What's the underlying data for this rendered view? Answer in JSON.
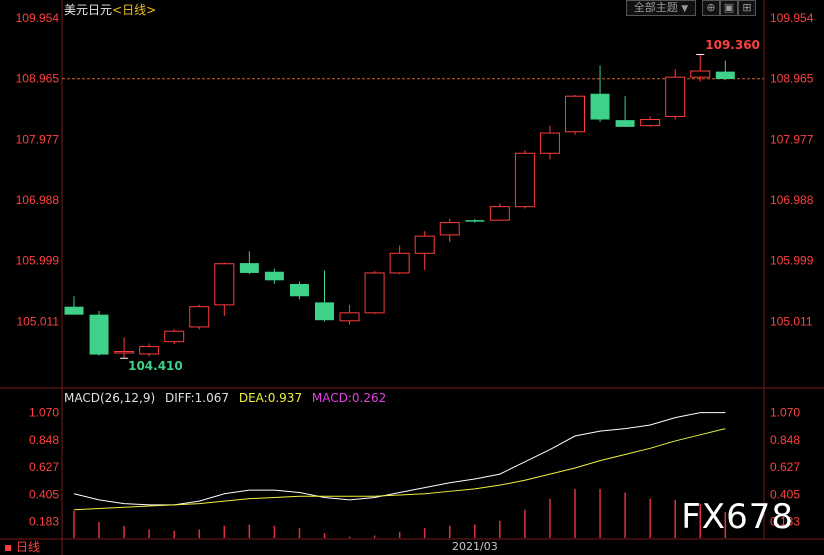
{
  "header": {
    "symbol": "美元日元",
    "period": "<日线>"
  },
  "toolbar": {
    "all_themes": "全部主题",
    "dropdown_glyph": "▼",
    "icon1": "⊕",
    "icon2": "▣",
    "icon3": "⊞"
  },
  "price_axis": {
    "ticks": [
      "109.954",
      "108.965",
      "107.977",
      "106.988",
      "105.999",
      "105.011"
    ]
  },
  "macd_axis": {
    "ticks": [
      "1.070",
      "0.848",
      "0.627",
      "0.405",
      "0.183"
    ]
  },
  "macd_header": {
    "title": "MACD(26,12,9)",
    "diff": "DIFF:1.067",
    "dea": "DEA:0.937",
    "macd": "MACD:0.262"
  },
  "annotations": {
    "high": "109.360",
    "low": "104.410"
  },
  "bottom": {
    "tab": "日线",
    "month": "2021/03"
  },
  "watermark": "FX678",
  "colors": {
    "up": "#ff3c3c",
    "down": "#3fd08a",
    "diff_line": "#ffffff",
    "dea_line": "#f0f040",
    "macd_text": "#e040e0",
    "axis_text": "#ff4040"
  },
  "chart_data": [
    {
      "type": "candlestick",
      "title": "美元日元<日线>",
      "ylim": [
        104.3,
        109.954
      ],
      "ref_line": 108.965,
      "candles": [
        {
          "o": 105.25,
          "h": 105.42,
          "l": 105.13,
          "c": 105.12
        },
        {
          "o": 105.12,
          "h": 105.18,
          "l": 104.45,
          "c": 104.47
        },
        {
          "o": 104.5,
          "h": 104.75,
          "l": 104.41,
          "c": 104.52
        },
        {
          "o": 104.48,
          "h": 104.65,
          "l": 104.44,
          "c": 104.6
        },
        {
          "o": 104.68,
          "h": 104.88,
          "l": 104.64,
          "c": 104.85
        },
        {
          "o": 104.92,
          "h": 105.28,
          "l": 104.88,
          "c": 105.25
        },
        {
          "o": 105.28,
          "h": 105.97,
          "l": 105.1,
          "c": 105.95
        },
        {
          "o": 105.96,
          "h": 106.15,
          "l": 105.78,
          "c": 105.8
        },
        {
          "o": 105.82,
          "h": 105.87,
          "l": 105.62,
          "c": 105.68
        },
        {
          "o": 105.62,
          "h": 105.66,
          "l": 105.37,
          "c": 105.42
        },
        {
          "o": 105.32,
          "h": 105.84,
          "l": 105.01,
          "c": 105.03
        },
        {
          "o": 105.02,
          "h": 105.28,
          "l": 104.96,
          "c": 105.15
        },
        {
          "o": 105.15,
          "h": 105.83,
          "l": 105.13,
          "c": 105.8
        },
        {
          "o": 105.8,
          "h": 106.25,
          "l": 105.78,
          "c": 106.12
        },
        {
          "o": 106.12,
          "h": 106.48,
          "l": 105.85,
          "c": 106.4
        },
        {
          "o": 106.42,
          "h": 106.68,
          "l": 106.3,
          "c": 106.62
        },
        {
          "o": 106.66,
          "h": 106.68,
          "l": 106.62,
          "c": 106.64
        },
        {
          "o": 106.66,
          "h": 106.93,
          "l": 106.65,
          "c": 106.88
        },
        {
          "o": 106.88,
          "h": 107.8,
          "l": 106.85,
          "c": 107.75
        },
        {
          "o": 107.75,
          "h": 108.2,
          "l": 107.65,
          "c": 108.08
        },
        {
          "o": 108.1,
          "h": 108.7,
          "l": 108.05,
          "c": 108.68
        },
        {
          "o": 108.72,
          "h": 109.18,
          "l": 108.26,
          "c": 108.3
        },
        {
          "o": 108.29,
          "h": 108.68,
          "l": 108.18,
          "c": 108.18
        },
        {
          "o": 108.2,
          "h": 108.35,
          "l": 108.18,
          "c": 108.3
        },
        {
          "o": 108.35,
          "h": 109.12,
          "l": 108.3,
          "c": 108.99
        },
        {
          "o": 108.99,
          "h": 109.36,
          "l": 108.92,
          "c": 109.09
        },
        {
          "o": 109.08,
          "h": 109.26,
          "l": 108.94,
          "c": 108.96
        }
      ]
    },
    {
      "type": "line",
      "title": "MACD(26,12,9)",
      "ylim": [
        0.05,
        1.1
      ],
      "x": [
        1,
        2,
        3,
        4,
        5,
        6,
        7,
        8,
        9,
        10,
        11,
        12,
        13,
        14,
        15,
        16,
        17,
        18,
        19,
        20,
        21,
        22,
        23,
        24,
        25,
        26,
        27
      ],
      "series": [
        {
          "name": "DIFF",
          "values": [
            0.41,
            0.36,
            0.33,
            0.32,
            0.32,
            0.35,
            0.41,
            0.44,
            0.44,
            0.42,
            0.38,
            0.36,
            0.38,
            0.42,
            0.46,
            0.5,
            0.53,
            0.57,
            0.67,
            0.77,
            0.88,
            0.92,
            0.94,
            0.97,
            1.03,
            1.07,
            1.07
          ]
        },
        {
          "name": "DEA",
          "values": [
            0.28,
            0.29,
            0.3,
            0.31,
            0.32,
            0.33,
            0.35,
            0.37,
            0.38,
            0.39,
            0.39,
            0.39,
            0.39,
            0.4,
            0.41,
            0.43,
            0.45,
            0.48,
            0.52,
            0.57,
            0.62,
            0.68,
            0.73,
            0.78,
            0.84,
            0.89,
            0.94
          ]
        },
        {
          "name": "MACD",
          "values": [
            0.27,
            0.18,
            0.15,
            0.12,
            0.11,
            0.12,
            0.15,
            0.16,
            0.15,
            0.13,
            0.09,
            0.06,
            0.07,
            0.1,
            0.13,
            0.15,
            0.16,
            0.19,
            0.28,
            0.37,
            0.45,
            0.45,
            0.42,
            0.37,
            0.36,
            0.33,
            0.26
          ]
        }
      ]
    }
  ]
}
